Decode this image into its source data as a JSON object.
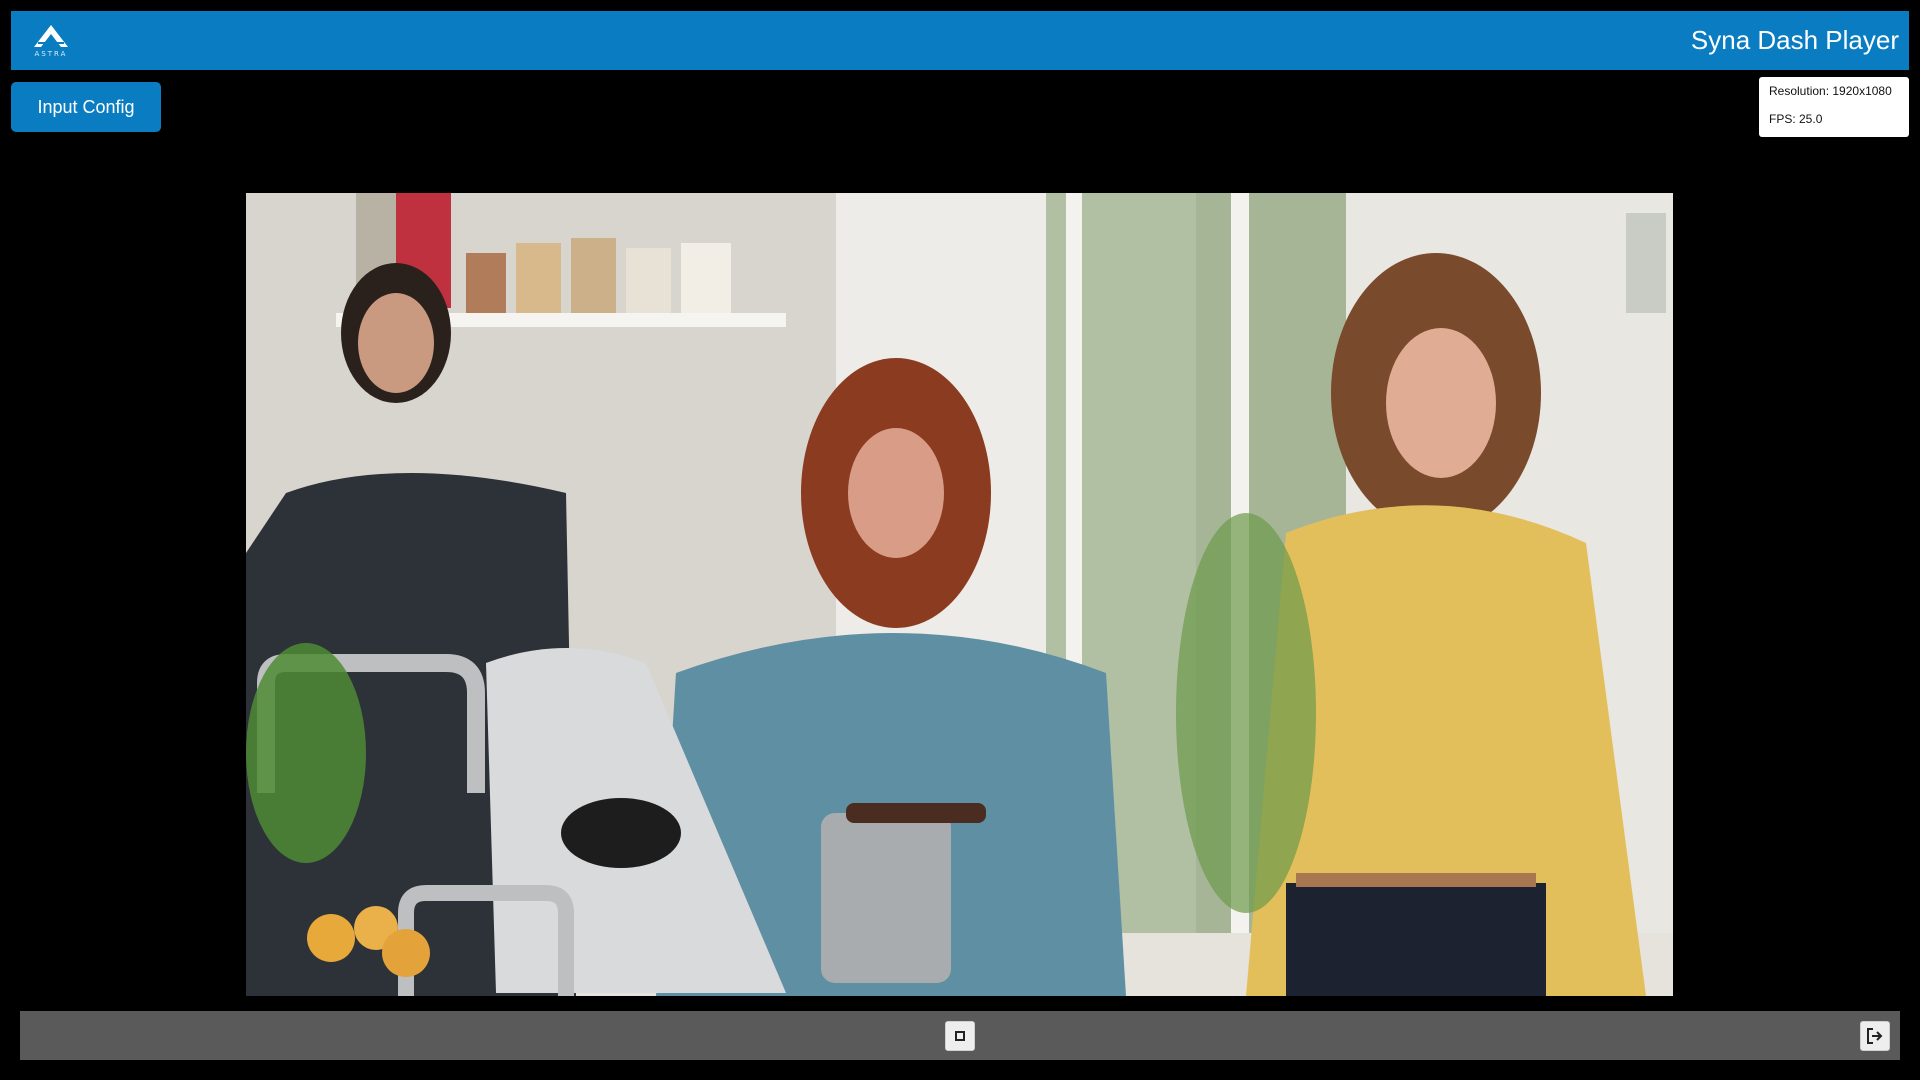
{
  "header": {
    "logo_text": "ASTRA",
    "logo_icon": "astra-logo-triangle",
    "title": "Syna Dash Player"
  },
  "toolbar": {
    "config_label": "Input Config"
  },
  "stats": {
    "resolution": "Resolution: 1920x1080",
    "fps": "FPS: 25.0"
  },
  "video": {
    "description_icon": "video-frame"
  },
  "controls": {
    "stop_icon": "stop-icon",
    "exit_icon": "exit-icon"
  },
  "colors": {
    "accent": "#0a7dc2",
    "background": "#000000",
    "control_bar": "#5a5a5a"
  }
}
